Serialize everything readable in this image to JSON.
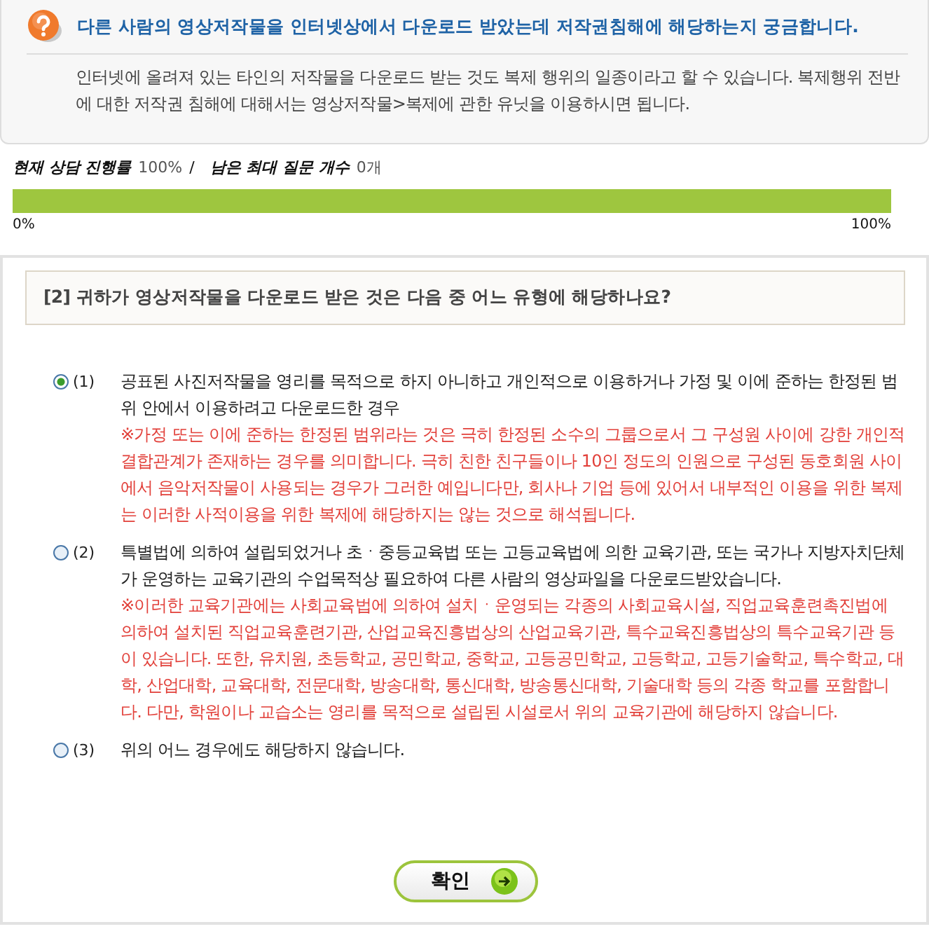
{
  "faq": {
    "question": "다른 사람의 영상저작물을 인터넷상에서 다운로드 받았는데 저작권침해에 해당하는지 궁금합니다.",
    "answer": "인터넷에 올려져 있는 타인의 저작물을 다운로드 받는 것도 복제 행위의 일종이라고 할 수 있습니다. 복제행위 전반에 대한 저작권 침해에 대해서는 영상저작물>복제에 관한 유닛을 이용하시면 됩니다."
  },
  "progress": {
    "label": "현재 상담 진행률",
    "value": "100%",
    "separator": "/",
    "remaining_label": "남은 최대 질문 개수",
    "remaining_value": "0개",
    "level": 1.0,
    "min_label": "0%",
    "max_label": "100%"
  },
  "question": {
    "title": "[2] 귀하가 영상저작물을 다운로드 받은 것은 다음 중 어느 유형에 해당하나요?",
    "options": [
      {
        "number": "(1)",
        "selected": true,
        "text": "공표된 사진저작물을 영리를 목적으로 하지 아니하고 개인적으로 이용하거나 가정 및 이에 준하는 한정된 범위 안에서 이용하려고 다운로드한 경우",
        "note": "※가정 또는 이에 준하는 한정된 범위라는 것은 극히 한정된 소수의 그룹으로서 그 구성원 사이에 강한 개인적 결합관계가 존재하는 경우를 의미합니다. 극히 친한 친구들이나 10인 정도의 인원으로 구성된 동호회원 사이에서 음악저작물이 사용되는 경우가 그러한 예입니다만, 회사나 기업 등에 있어서 내부적인 이용을 위한 복제는 이러한 사적이용을 위한 복제에 해당하지는 않는 것으로 해석됩니다."
      },
      {
        "number": "(2)",
        "selected": false,
        "text": "특별법에 의하여 설립되었거나 초ㆍ중등교육법 또는 고등교육법에 의한 교육기관, 또는 국가나 지방자치단체가 운영하는 교육기관의 수업목적상 필요하여 다른 사람의 영상파일을 다운로드받았습니다.",
        "note": "※이러한 교육기관에는 사회교육법에 의하여 설치ㆍ운영되는 각종의 사회교육시설, 직업교육훈련촉진법에 의하여 설치된 직업교육훈련기관, 산업교육진흥법상의 산업교육기관, 특수교육진흥법상의 특수교육기관 등이 있습니다. 또한, 유치원, 초등학교, 공민학교, 중학교, 고등공민학교, 고등학교, 고등기술학교, 특수학교, 대학, 산업대학, 교육대학, 전문대학, 방송대학, 통신대학, 방송통신대학, 기술대학 등의 각종 학교를 포함합니다. 다만, 학원이나 교습소는 영리를 목적으로 설립된 시설로서 위의 교육기관에 해당하지 않습니다."
      },
      {
        "number": "(3)",
        "selected": false,
        "text": "위의 어느 경우에도 해당하지 않습니다."
      }
    ]
  },
  "confirm_button": "확인"
}
